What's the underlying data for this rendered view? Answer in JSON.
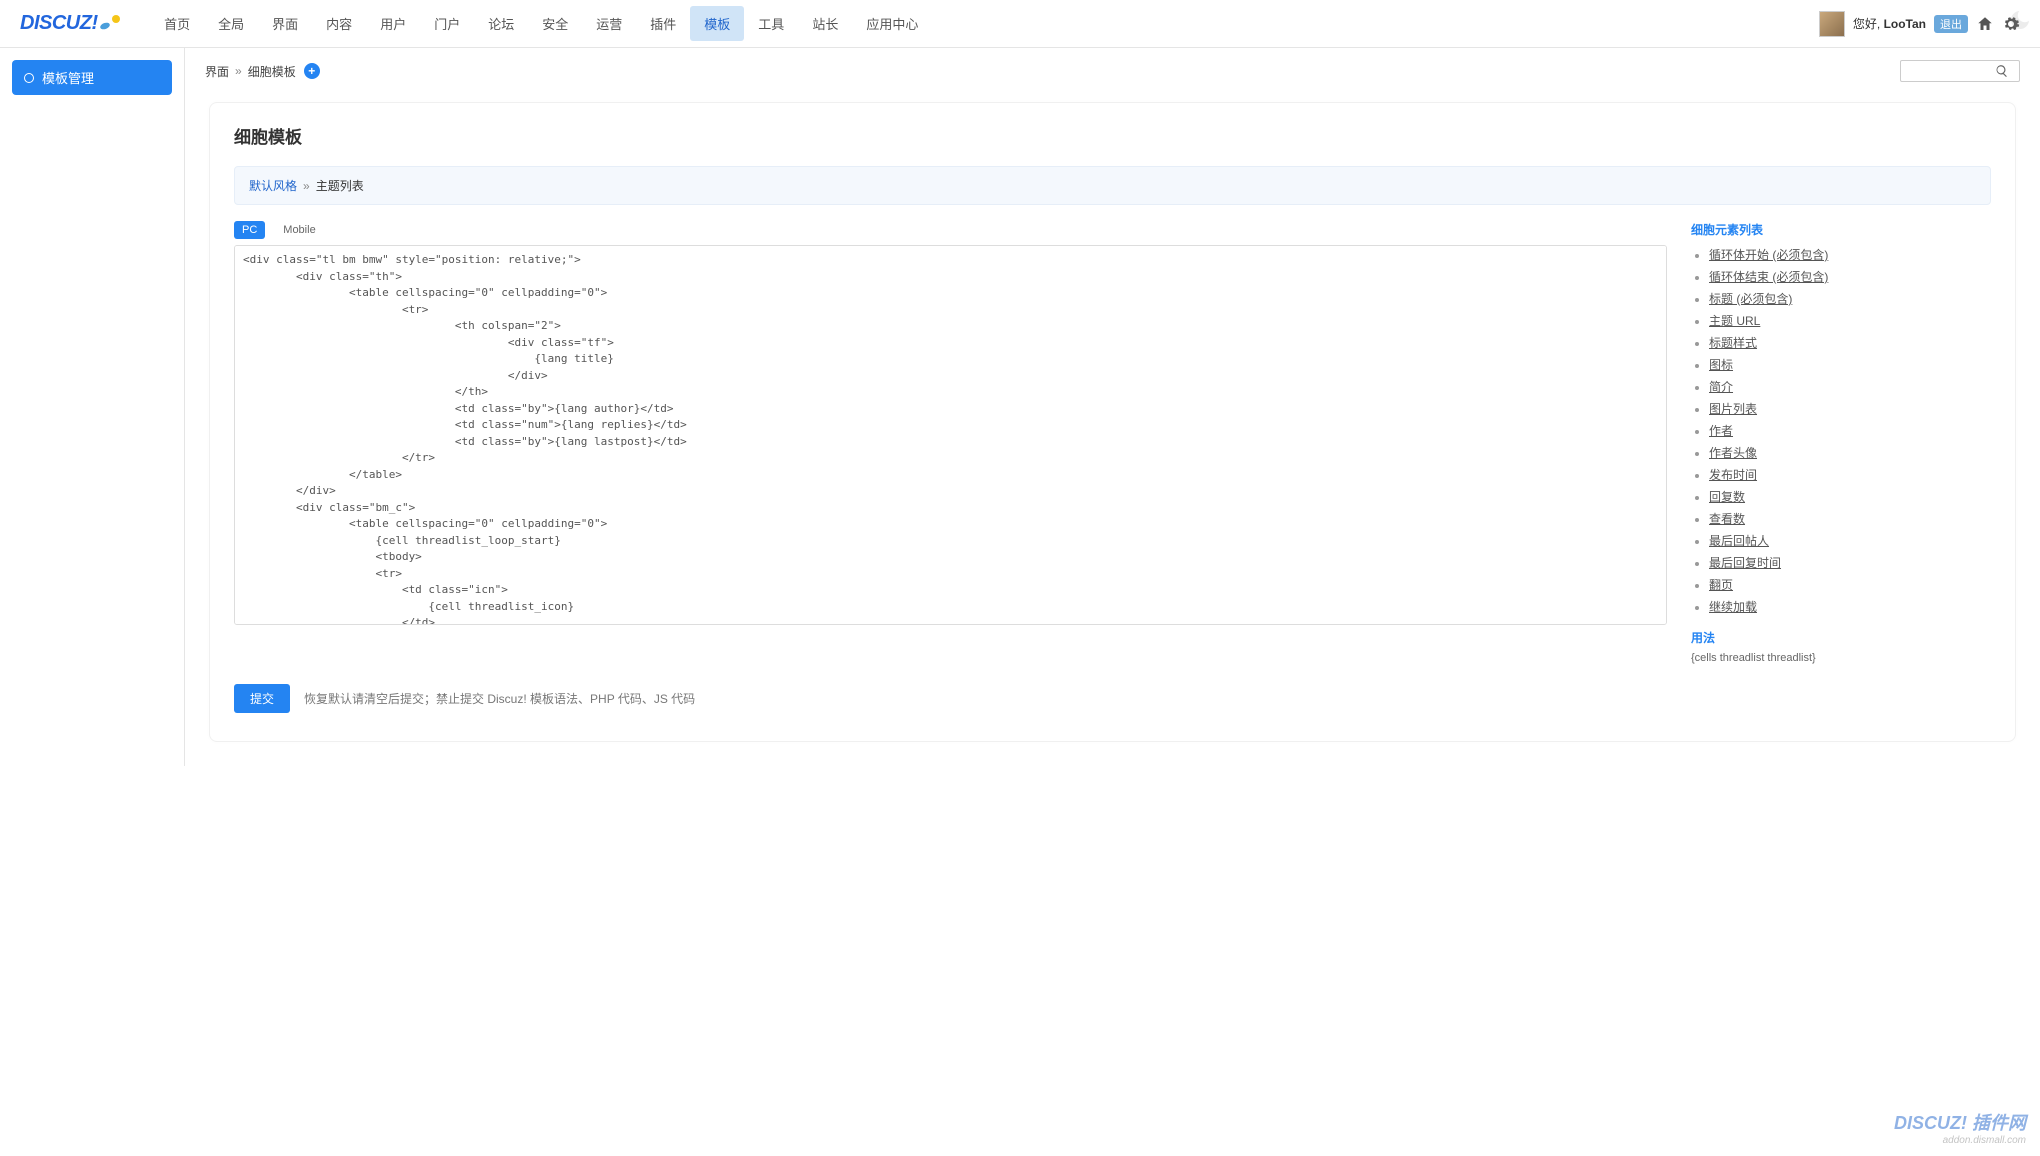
{
  "logo_text": "DISCUZ",
  "top_nav": [
    "首页",
    "全局",
    "界面",
    "内容",
    "用户",
    "门户",
    "论坛",
    "安全",
    "运营",
    "插件",
    "模板",
    "工具",
    "站长",
    "应用中心"
  ],
  "top_nav_active": 10,
  "greeting_prefix": "您好, ",
  "username": "LooTan",
  "logout": "退出",
  "sidebar": {
    "manage": "模板管理"
  },
  "breadcrumb": {
    "a": "界面",
    "sep": "»",
    "b": "细胞模板"
  },
  "search_placeholder": "",
  "card": {
    "title": "细胞模板",
    "sub_a": "默认风格",
    "sub_sep": "»",
    "sub_b": "主题列表"
  },
  "tabs": {
    "pc": "PC",
    "mobile": "Mobile"
  },
  "code": "<div class=\"tl bm bmw\" style=\"position: relative;\">\n        <div class=\"th\">\n                <table cellspacing=\"0\" cellpadding=\"0\">\n                        <tr>\n                                <th colspan=\"2\">\n                                        <div class=\"tf\">\n                                            {lang title}\n                                        </div>\n                                </th>\n                                <td class=\"by\">{lang author}</td>\n                                <td class=\"num\">{lang replies}</td>\n                                <td class=\"by\">{lang lastpost}</td>\n                        </tr>\n                </table>\n        </div>\n        <div class=\"bm_c\">\n                <table cellspacing=\"0\" cellpadding=\"0\">\n                    {cell threadlist_loop_start}\n                    <tbody>\n                    <tr>\n                        <td class=\"icn\">\n                            {cell threadlist_icon}\n                        </td>\n                        <th class=\"{cell threadlist_folder_class}\">\n                            {cell threadlist_subject}\n                        </th>\n                        <td class=\"by\">\n                            <cite>\n                                {cell threadlist_author}\n                            </cite>\n                            <em>{cell threadlist_dateline}</em>\n                        </td>\n                        <td class=\"num\">{cell threadlist_replies}<em>{cell threadlist_views}</em></td>\n                        <td class=\"by\">\n                            <cite>{cell threadlist_lastposter}</cite>",
  "right": {
    "list_title": "细胞元素列表",
    "items": [
      "循环体开始 (必须包含)",
      "循环体结束 (必须包含)",
      "标题 (必须包含)",
      "主题 URL",
      "标题样式",
      "图标",
      "简介",
      "图片列表",
      "作者",
      "作者头像",
      "发布时间",
      "回复数",
      "查看数",
      "最后回帖人",
      "最后回复时间",
      "翻页",
      "继续加载"
    ],
    "usage_title": "用法",
    "usage_code": "{cells threadlist threadlist}"
  },
  "submit": {
    "btn": "提交",
    "hint": "恢复默认请清空后提交；禁止提交 Discuz! 模板语法、PHP 代码、JS 代码"
  },
  "watermark": {
    "brand": "DISCUZ! 插件网",
    "sub": "addon.dismall.com"
  }
}
